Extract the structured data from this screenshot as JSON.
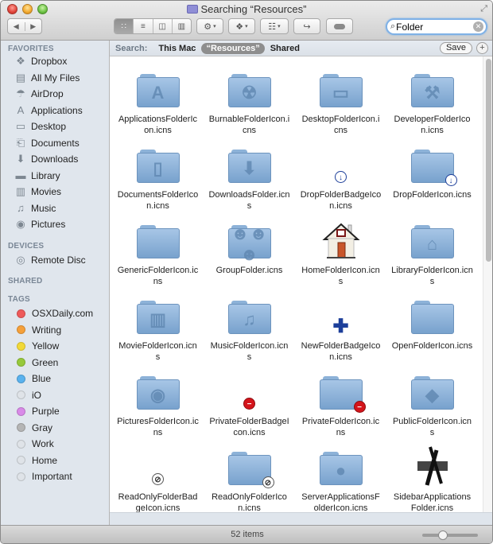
{
  "window": {
    "title": "Searching “Resources”",
    "status": "52 items",
    "icon_size_fraction": 0.35
  },
  "toolbar": {
    "back_icon": "◀",
    "forward_icon": "▶",
    "views": [
      {
        "name": "icon-view",
        "glyph": "∷",
        "selected": true
      },
      {
        "name": "list-view",
        "glyph": "≡",
        "selected": false
      },
      {
        "name": "column-view",
        "glyph": "◫",
        "selected": false
      },
      {
        "name": "coverflow-view",
        "glyph": "▥",
        "selected": false
      }
    ],
    "action_glyph": "⚙",
    "dropbox_glyph": "❖",
    "arrange_glyph": "☷",
    "share_glyph": "↪",
    "caret": "▾",
    "search_value": "Folder",
    "search_icon": "⌕",
    "clear_icon": "✕",
    "fullscreen_icon": "⤢"
  },
  "searchbar": {
    "label": "Search:",
    "scopes": [
      "This Mac",
      "“Resources”",
      "Shared"
    ],
    "selected_scope": 1,
    "save_label": "Save",
    "add_label": "+"
  },
  "sidebar": {
    "favorites_header": "FAVORITES",
    "favorites": [
      {
        "label": "Dropbox",
        "icon": "dropbox-icon",
        "glyph": "❖"
      },
      {
        "label": "All My Files",
        "icon": "all-my-files-icon",
        "glyph": "▤"
      },
      {
        "label": "AirDrop",
        "icon": "airdrop-icon",
        "glyph": "☂"
      },
      {
        "label": "Applications",
        "icon": "applications-icon",
        "glyph": "A"
      },
      {
        "label": "Desktop",
        "icon": "desktop-icon",
        "glyph": "▭"
      },
      {
        "label": "Documents",
        "icon": "documents-icon",
        "glyph": "⎗"
      },
      {
        "label": "Downloads",
        "icon": "downloads-icon",
        "glyph": "⬇"
      },
      {
        "label": "Library",
        "icon": "library-icon",
        "glyph": "▬"
      },
      {
        "label": "Movies",
        "icon": "movies-icon",
        "glyph": "▥"
      },
      {
        "label": "Music",
        "icon": "music-icon",
        "glyph": "♫"
      },
      {
        "label": "Pictures",
        "icon": "pictures-icon",
        "glyph": "◉"
      }
    ],
    "devices_header": "DEVICES",
    "devices": [
      {
        "label": "Remote Disc",
        "icon": "remote-disc-icon",
        "glyph": "◎"
      }
    ],
    "shared_header": "SHARED",
    "tags_header": "TAGS",
    "tags": [
      {
        "label": "OSXDaily.com",
        "color": "#ee5a5a"
      },
      {
        "label": "Writing",
        "color": "#f5a03a"
      },
      {
        "label": "Yellow",
        "color": "#f2d938"
      },
      {
        "label": "Green",
        "color": "#97c93b"
      },
      {
        "label": "Blue",
        "color": "#5ab2ee"
      },
      {
        "label": "iO",
        "color": "#dfe3e8"
      },
      {
        "label": "Purple",
        "color": "#d98ae8"
      },
      {
        "label": "Gray",
        "color": "#b5b5b5"
      },
      {
        "label": "Work",
        "color": "#dfe3e8"
      },
      {
        "label": "Home",
        "color": "#dfe3e8"
      },
      {
        "label": "Important",
        "color": "#dfe3e8"
      }
    ]
  },
  "files": [
    {
      "name": "ApplicationsFolderIcon.icns",
      "kind": "folder",
      "glyph": "A",
      "icon": "applications-folder-icon"
    },
    {
      "name": "BurnableFolderIcon.icns",
      "kind": "folder",
      "glyph": "☢",
      "icon": "burnable-folder-icon"
    },
    {
      "name": "DesktopFolderIcon.icns",
      "kind": "folder",
      "glyph": "▭",
      "icon": "desktop-folder-icon"
    },
    {
      "name": "DeveloperFolderIcon.icns",
      "kind": "folder",
      "glyph": "⚒",
      "icon": "developer-folder-icon"
    },
    {
      "name": "DocumentsFolderIcon.icns",
      "kind": "folder",
      "glyph": "▯",
      "icon": "documents-folder-icon"
    },
    {
      "name": "DownloadsFolder.icns",
      "kind": "folder",
      "glyph": "⬇",
      "icon": "downloads-folder-icon"
    },
    {
      "name": "DropFolderBadgeIcon.icns",
      "kind": "badge",
      "badge": "blue",
      "glyph": "↓",
      "icon": "drop-badge-icon"
    },
    {
      "name": "DropFolderIcon.icns",
      "kind": "folder",
      "glyph": "",
      "badge": "blue",
      "badge_glyph": "↓",
      "icon": "drop-folder-icon"
    },
    {
      "name": "GenericFolderIcon.icns",
      "kind": "folder",
      "glyph": "",
      "icon": "generic-folder-icon"
    },
    {
      "name": "GroupFolder.icns",
      "kind": "folder",
      "glyph": "☻☻☻",
      "icon": "group-folder-icon"
    },
    {
      "name": "HomeFolderIcon.icns",
      "kind": "house",
      "icon": "home-folder-icon"
    },
    {
      "name": "LibraryFolderIcon.icns",
      "kind": "folder",
      "glyph": "⌂",
      "icon": "library-folder-icon"
    },
    {
      "name": "MovieFolderIcon.icns",
      "kind": "folder",
      "glyph": "▥",
      "icon": "movie-folder-icon"
    },
    {
      "name": "MusicFolderIcon.icns",
      "kind": "folder",
      "glyph": "♫",
      "icon": "music-folder-icon"
    },
    {
      "name": "NewFolderBadgeIcon.icns",
      "kind": "plus",
      "icon": "new-folder-badge-icon"
    },
    {
      "name": "OpenFolderIcon.icns",
      "kind": "folder",
      "glyph": "",
      "icon": "open-folder-icon"
    },
    {
      "name": "PicturesFolderIcon.icns",
      "kind": "folder",
      "glyph": "◉",
      "icon": "pictures-folder-icon"
    },
    {
      "name": "PrivateFolderBadgeIcon.icns",
      "kind": "badge",
      "badge": "red",
      "glyph": "−",
      "icon": "private-badge-icon"
    },
    {
      "name": "PrivateFolderIcon.icns",
      "kind": "folder",
      "glyph": "",
      "badge": "red",
      "badge_glyph": "−",
      "icon": "private-folder-icon"
    },
    {
      "name": "PublicFolderIcon.icns",
      "kind": "folder",
      "glyph": "◆",
      "icon": "public-folder-icon"
    },
    {
      "name": "ReadOnlyFolderBadgeIcon.icns",
      "kind": "badge",
      "badge": "gray",
      "glyph": "⊘",
      "icon": "readonly-badge-icon"
    },
    {
      "name": "ReadOnlyFolderIcon.icns",
      "kind": "folder",
      "glyph": "",
      "badge": "gray",
      "badge_glyph": "⊘",
      "icon": "readonly-folder-icon"
    },
    {
      "name": "ServerApplicationsFolderIcon.icns",
      "kind": "folder",
      "glyph": "●",
      "icon": "server-applications-folder-icon"
    },
    {
      "name": "SidebarApplicationsFolder.icns",
      "kind": "apps",
      "glyph": "A",
      "icon": "sidebar-applications-icon"
    }
  ]
}
